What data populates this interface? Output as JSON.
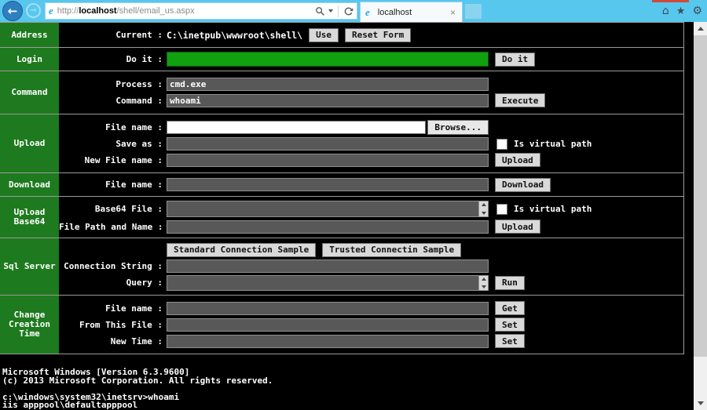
{
  "browser": {
    "back_arrow": "←",
    "forward_arrow": "→",
    "url": {
      "scheme": "http://",
      "host": "localhost",
      "path": "/shell/email_us.aspx"
    },
    "tab": {
      "title": "localhost",
      "close": "×"
    },
    "icons": {
      "home": "⌂",
      "star": "★",
      "gear": "⚙",
      "ie_logo": "e"
    }
  },
  "colors": {
    "chrome_blue": "#58c7ee",
    "section_green": "#1e7a1e",
    "login_input_green": "#10a010",
    "input_gray": "#585858"
  },
  "shell": {
    "address": {
      "section": "Address",
      "current_label": "Current :",
      "current_value": "C:\\inetpub\\wwwroot\\shell\\",
      "use_button": "Use",
      "reset_button": "Reset Form"
    },
    "login": {
      "section": "Login",
      "field_label": "Do it :",
      "button": "Do it"
    },
    "command": {
      "section": "Command",
      "process_label": "Process :",
      "process_value": "cmd.exe",
      "command_label": "Command :",
      "command_value": "whoami",
      "button": "Execute"
    },
    "upload": {
      "section": "Upload",
      "file_label": "File name :",
      "browse_button": "Browse...",
      "save_label": "Save as :",
      "virtual_label": "Is virtual path",
      "new_file_label": "New File name :",
      "button": "Upload"
    },
    "download": {
      "section": "Download",
      "file_label": "File name :",
      "button": "Download"
    },
    "upload_base64": {
      "section_line1": "Upload",
      "section_line2": "Base64",
      "base64_label": "Base64 File :",
      "virtual_label": "Is virtual path",
      "path_label": "File Path and Name :",
      "button": "Upload"
    },
    "sql": {
      "section": "Sql Server",
      "standard_button": "Standard Connection Sample",
      "trusted_button": "Trusted Connectin Sample",
      "connection_label": "Connection String :",
      "query_label": "Query :",
      "button": "Run"
    },
    "creation_time": {
      "section_line1": "Change",
      "section_line2": "Creation",
      "section_line3": "Time",
      "file_label": "File name :",
      "get_button": "Get",
      "from_label": "From This File :",
      "set_button": "Set",
      "new_time_label": "New Time :",
      "set_button2": "Set"
    }
  },
  "console": {
    "lines": [
      "Microsoft Windows [Version 6.3.9600]",
      "(c) 2013 Microsoft Corporation. All rights reserved.",
      "",
      "c:\\windows\\system32\\inetsrv>whoami",
      "iis apppool\\defaultapppool"
    ]
  }
}
